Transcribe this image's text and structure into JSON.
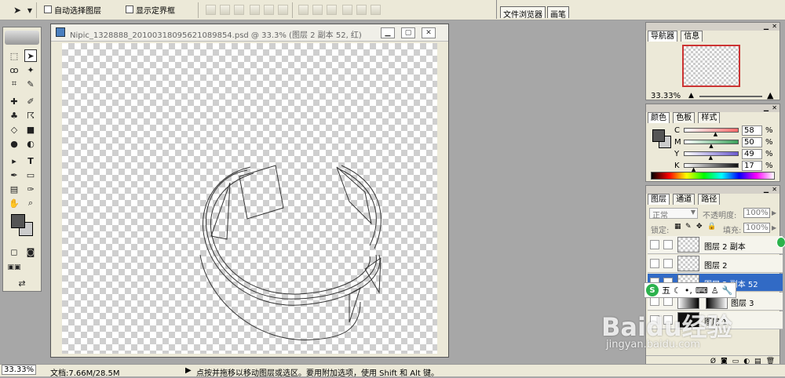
{
  "options_bar": {
    "auto_select_label": "自动选择图层",
    "show_bounds_label": "显示定界框",
    "move_tool_icon": "move-arrow-icon"
  },
  "palette_well": {
    "tabs": [
      "文件浏览器",
      "画笔"
    ]
  },
  "document": {
    "title": "Nipic_1328888_20100318095621089854.psd @ 33.3% (图层 2 副本 52, 红)",
    "window_buttons": [
      "minimize",
      "maximize",
      "close"
    ]
  },
  "status_bar": {
    "zoom": "33.33%",
    "doc_size": "文档:7.66M/28.5M",
    "hint": "点按并拖移以移动图层或选区。要用附加选项，使用 Shift 和 Alt 键。"
  },
  "navigator": {
    "tabs": [
      "导航器",
      "信息"
    ],
    "zoom": "33.33%"
  },
  "color_panel": {
    "tabs": [
      "颜色",
      "色板",
      "样式"
    ],
    "channels": [
      {
        "label": "C",
        "value": "58",
        "unit": "%",
        "level": 0.58,
        "gradient": "#ff6a6a"
      },
      {
        "label": "M",
        "value": "50",
        "unit": "%",
        "level": 0.5,
        "gradient": "#3aa05a"
      },
      {
        "label": "Y",
        "value": "49",
        "unit": "%",
        "level": 0.49,
        "gradient": "#6a5acd"
      },
      {
        "label": "K",
        "value": "17",
        "unit": "%",
        "level": 0.17,
        "gradient": "#111111"
      }
    ]
  },
  "layers_panel": {
    "tabs": [
      "图层",
      "通道",
      "路径"
    ],
    "blend_mode": "正常",
    "opacity_label": "不透明度:",
    "opacity_value": "100%",
    "lock_label": "锁定:",
    "fill_label": "填充:",
    "fill_value": "100%",
    "layers": [
      {
        "name": "图层 2 副本",
        "selected": false
      },
      {
        "name": "图层 2",
        "selected": false
      },
      {
        "name": "图层 2 副本 52",
        "selected": true
      },
      {
        "name": "图层 3",
        "selected": false
      },
      {
        "name": "图层 1",
        "selected": false
      }
    ]
  },
  "ime": {
    "logo": "S",
    "mode": "五"
  },
  "watermark": {
    "brand": "Baidu经验",
    "url": "jingyan.baidu.com"
  },
  "colors": {
    "selection_blue": "#316ac5",
    "panel_bg": "#ece9d8",
    "workspace_gray": "#a7a7a7"
  }
}
